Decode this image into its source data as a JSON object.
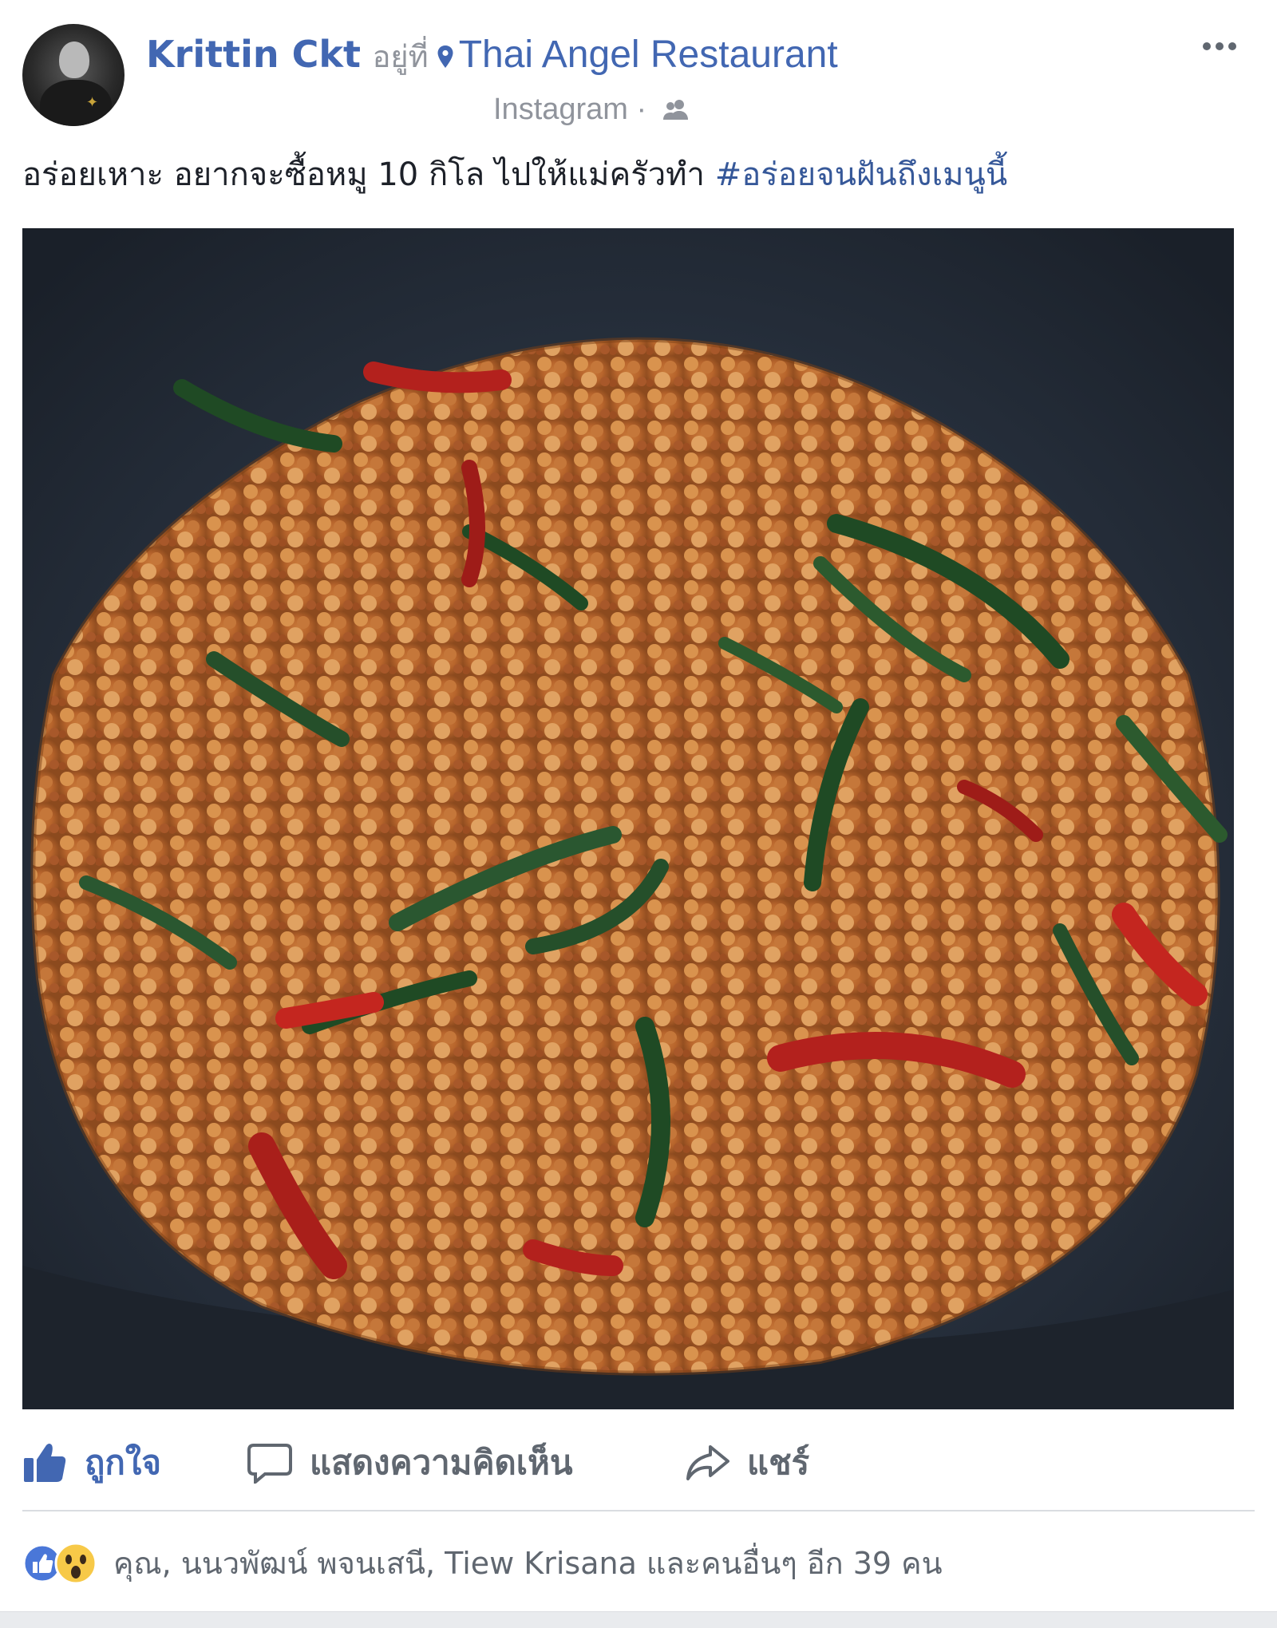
{
  "post": {
    "author": "Krittin Ckt",
    "at_text": "อยู่ที่",
    "place": "Thai Angel Restaurant",
    "source": "Instagram",
    "separator": "·",
    "audience_icon": "friends-icon",
    "more_icon": "more-icon",
    "text": "อร่อยเหาะ อยากจะซื้อหมู 10 กิโล ไปให้แม่ครัวทำ ",
    "hashtag": "#อร่อยจนฝันถึงเมนูนี้",
    "photo_alt": "photo"
  },
  "actions": {
    "like_label": "ถูกใจ",
    "comment_label": "แสดงความคิดเห็น",
    "share_label": "แชร์"
  },
  "reactions": {
    "summary": "คุณ, นนวพัฒน์ พจนเสนี, Tiew Krisana และคนอื่นๆ อีก 39 คน",
    "icons": [
      "like-reaction-icon",
      "wow-reaction-icon"
    ]
  },
  "colors": {
    "link": "#4267b2",
    "meta": "#90949c",
    "action": "#606770"
  }
}
